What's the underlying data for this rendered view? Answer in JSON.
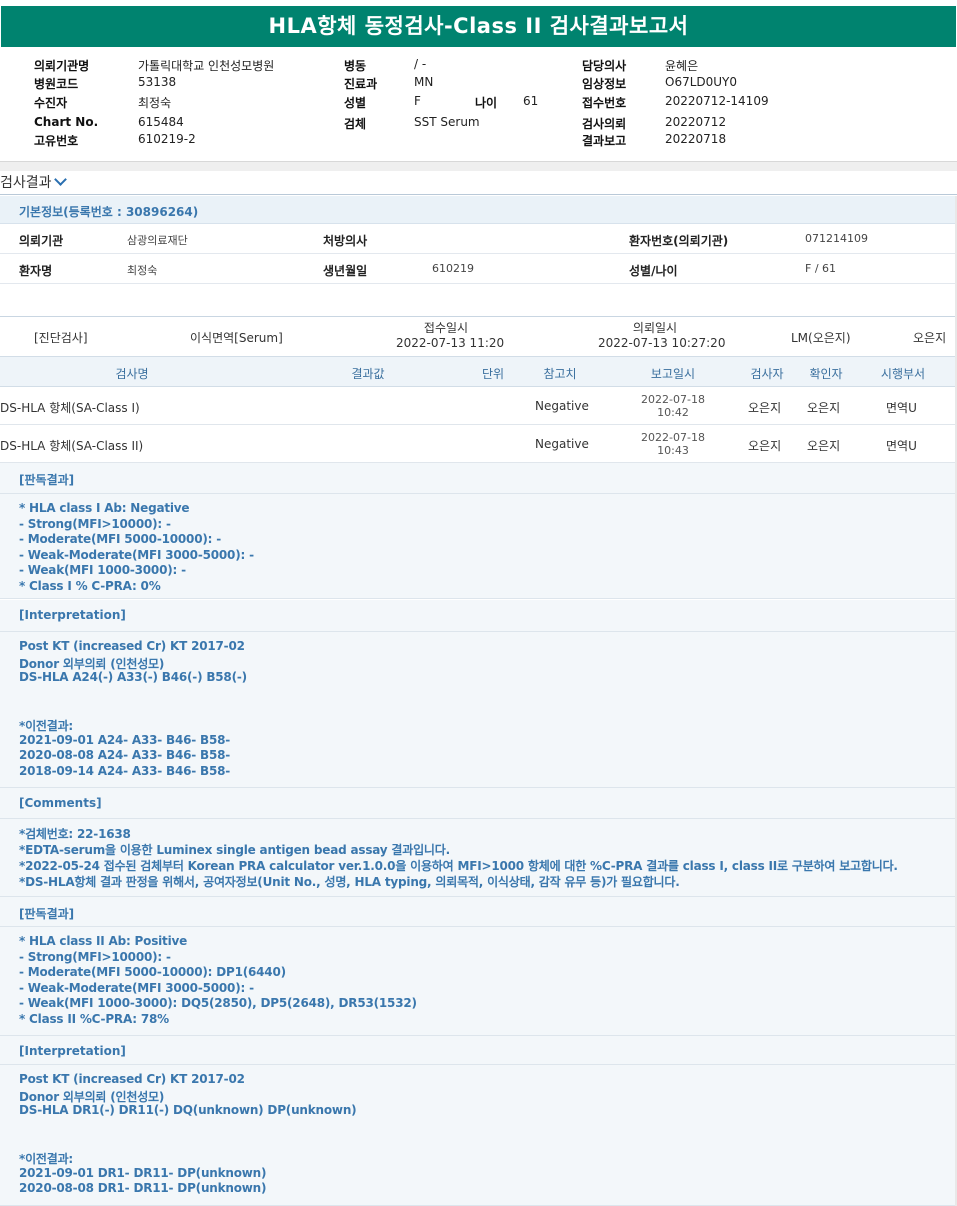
{
  "title": "HLA항체 동정검사-Class II 검사결과보고서",
  "header": {
    "rows": [
      [
        {
          "l": "의뢰기관명",
          "v": "가톨릭대학교 인천성모병원"
        },
        {
          "l": "병동",
          "v": "/ -"
        },
        {
          "l": "담당의사",
          "v": "윤혜은"
        }
      ],
      [
        {
          "l": "병원코드",
          "v": "53138"
        },
        {
          "l": "진료과",
          "v": "MN"
        },
        {
          "l": "임상정보",
          "v": "O67LD0UY0"
        }
      ],
      [
        {
          "l": "수진자",
          "v": "최정숙"
        },
        {
          "l": "성별",
          "v": "F"
        },
        {
          "l": "접수번호",
          "v": "20220712-14109"
        }
      ],
      [
        {
          "l": "Chart No.",
          "v": "615484"
        },
        {
          "l": "검체",
          "v": "SST Serum"
        },
        {
          "l": "검사의뢰",
          "v": "20220712"
        }
      ],
      [
        {
          "l": "고유번호",
          "v": "610219-2"
        },
        {
          "l": "",
          "v": ""
        },
        {
          "l": "결과보고",
          "v": "20220718"
        }
      ]
    ],
    "age_label": "나이",
    "age_value": "61"
  },
  "section": {
    "title": "검사결과"
  },
  "basic": {
    "title": "기본정보(등록번호 : 30896264)",
    "row1": {
      "l1": "의뢰기관",
      "v1": "삼광의료재단",
      "l2": "처방의사",
      "v2": "",
      "l3": "환자번호(의뢰기관)",
      "v3": "071214109"
    },
    "row2": {
      "l1": "환자명",
      "v1": "최정숙",
      "l2": "생년월일",
      "v2": "610219",
      "l3": "성별/나이",
      "v3": "F / 61"
    }
  },
  "order": {
    "type": "[진단검사]",
    "name": "이식면역[Serum]",
    "recv_label": "접수일시",
    "recv_value": "2022-07-13  11:20",
    "req_label": "의뢰일시",
    "req_value": "2022-07-13  10:27:20",
    "doctor": "LM(오은지)",
    "tester": "오은지"
  },
  "table": {
    "headers": [
      "검사명",
      "결과값",
      "단위",
      "참고치",
      "보고일시",
      "검사자",
      "확인자",
      "시행부서"
    ],
    "rows": [
      {
        "name": "DS-HLA 항체(SA-Class I)",
        "result": "",
        "unit": "",
        "ref": "Negative",
        "date": "2022-07-18",
        "time": "10:42",
        "tester": "오은지",
        "checker": "오은지",
        "dept": "면역U"
      },
      {
        "name": "DS-HLA 항체(SA-Class II)",
        "result": "",
        "unit": "",
        "ref": "Negative",
        "date": "2022-07-18",
        "time": "10:43",
        "tester": "오은지",
        "checker": "오은지",
        "dept": "면역U"
      }
    ]
  },
  "report": {
    "h1": "[판독결과]",
    "b1": [
      "* HLA class I Ab: Negative",
      "- Strong(MFI>10000): -",
      "- Moderate(MFI 5000-10000): -",
      "- Weak-Moderate(MFI 3000-5000): -",
      "- Weak(MFI 1000-3000): -",
      "* Class I % C-PRA: 0%"
    ],
    "h2": "[Interpretation]",
    "b2": [
      "Post KT (increased Cr) KT 2017-02",
      "Donor 외부의뢰 (인천성모)",
      "DS-HLA A24(-) A33(-) B46(-) B58(-)",
      "",
      "",
      "*이전결과:",
      "2021-09-01 A24- A33- B46- B58-",
      "2020-08-08 A24- A33- B46- B58-",
      "2018-09-14 A24- A33- B46- B58-"
    ],
    "h3": "[Comments]",
    "b3": [
      "*검체번호: 22-1638",
      "*EDTA-serum을 이용한 Luminex single antigen bead assay 결과입니다.",
      "*2022-05-24 접수된 검체부터 Korean PRA calculator ver.1.0.0을 이용하여 MFI>1000 항체에 대한 %C-PRA 결과를 class I, class II로 구분하여 보고합니다.",
      "*DS-HLA항체 결과 판정을 위해서, 공여자정보(Unit No., 성명, HLA typing, 의뢰목적, 이식상태, 감작 유무 등)가 필요합니다."
    ],
    "h4": "[판독결과]",
    "b4": [
      "* HLA class II Ab: Positive",
      "- Strong(MFI>10000): -",
      "- Moderate(MFI 5000-10000): DP1(6440)",
      "- Weak-Moderate(MFI 3000-5000): -",
      "- Weak(MFI 1000-3000): DQ5(2850), DP5(2648), DR53(1532)",
      "* Class II %C-PRA: 78%"
    ],
    "h5": "[Interpretation]",
    "b5": [
      "Post KT (increased Cr) KT 2017-02",
      "Donor 외부의뢰 (인천성모)",
      "DS-HLA DR1(-) DR11(-) DQ(unknown) DP(unknown)",
      "",
      "",
      "*이전결과:",
      "2021-09-01 DR1- DR11- DP(unknown)",
      "2020-08-08 DR1- DR11- DP(unknown)"
    ]
  }
}
